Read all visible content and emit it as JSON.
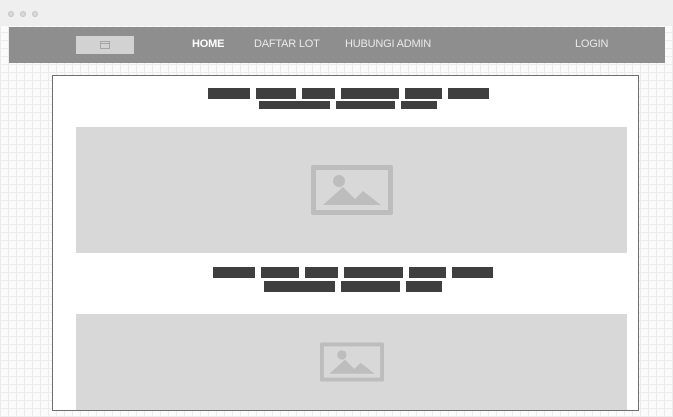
{
  "window": {
    "controls": [
      "close",
      "minimize",
      "maximize"
    ]
  },
  "navbar": {
    "logo_icon": "image-icon",
    "links": [
      {
        "label": "HOME",
        "active": true
      },
      {
        "label": "DAFTAR LOT",
        "active": false
      },
      {
        "label": "HUBUNGI ADMIN",
        "active": false
      }
    ],
    "login_label": "LOGIN"
  },
  "sections": [
    {
      "text_placeholder": "redacted-text",
      "image_placeholder": "image-icon"
    },
    {
      "text_placeholder": "redacted-text",
      "image_placeholder": "image-icon"
    }
  ],
  "colors": {
    "navbar": "#8e8e8e",
    "placeholder_block": "#3f3f3f",
    "image_panel": "#d8d8d8",
    "image_icon": "#bdbdbd"
  }
}
